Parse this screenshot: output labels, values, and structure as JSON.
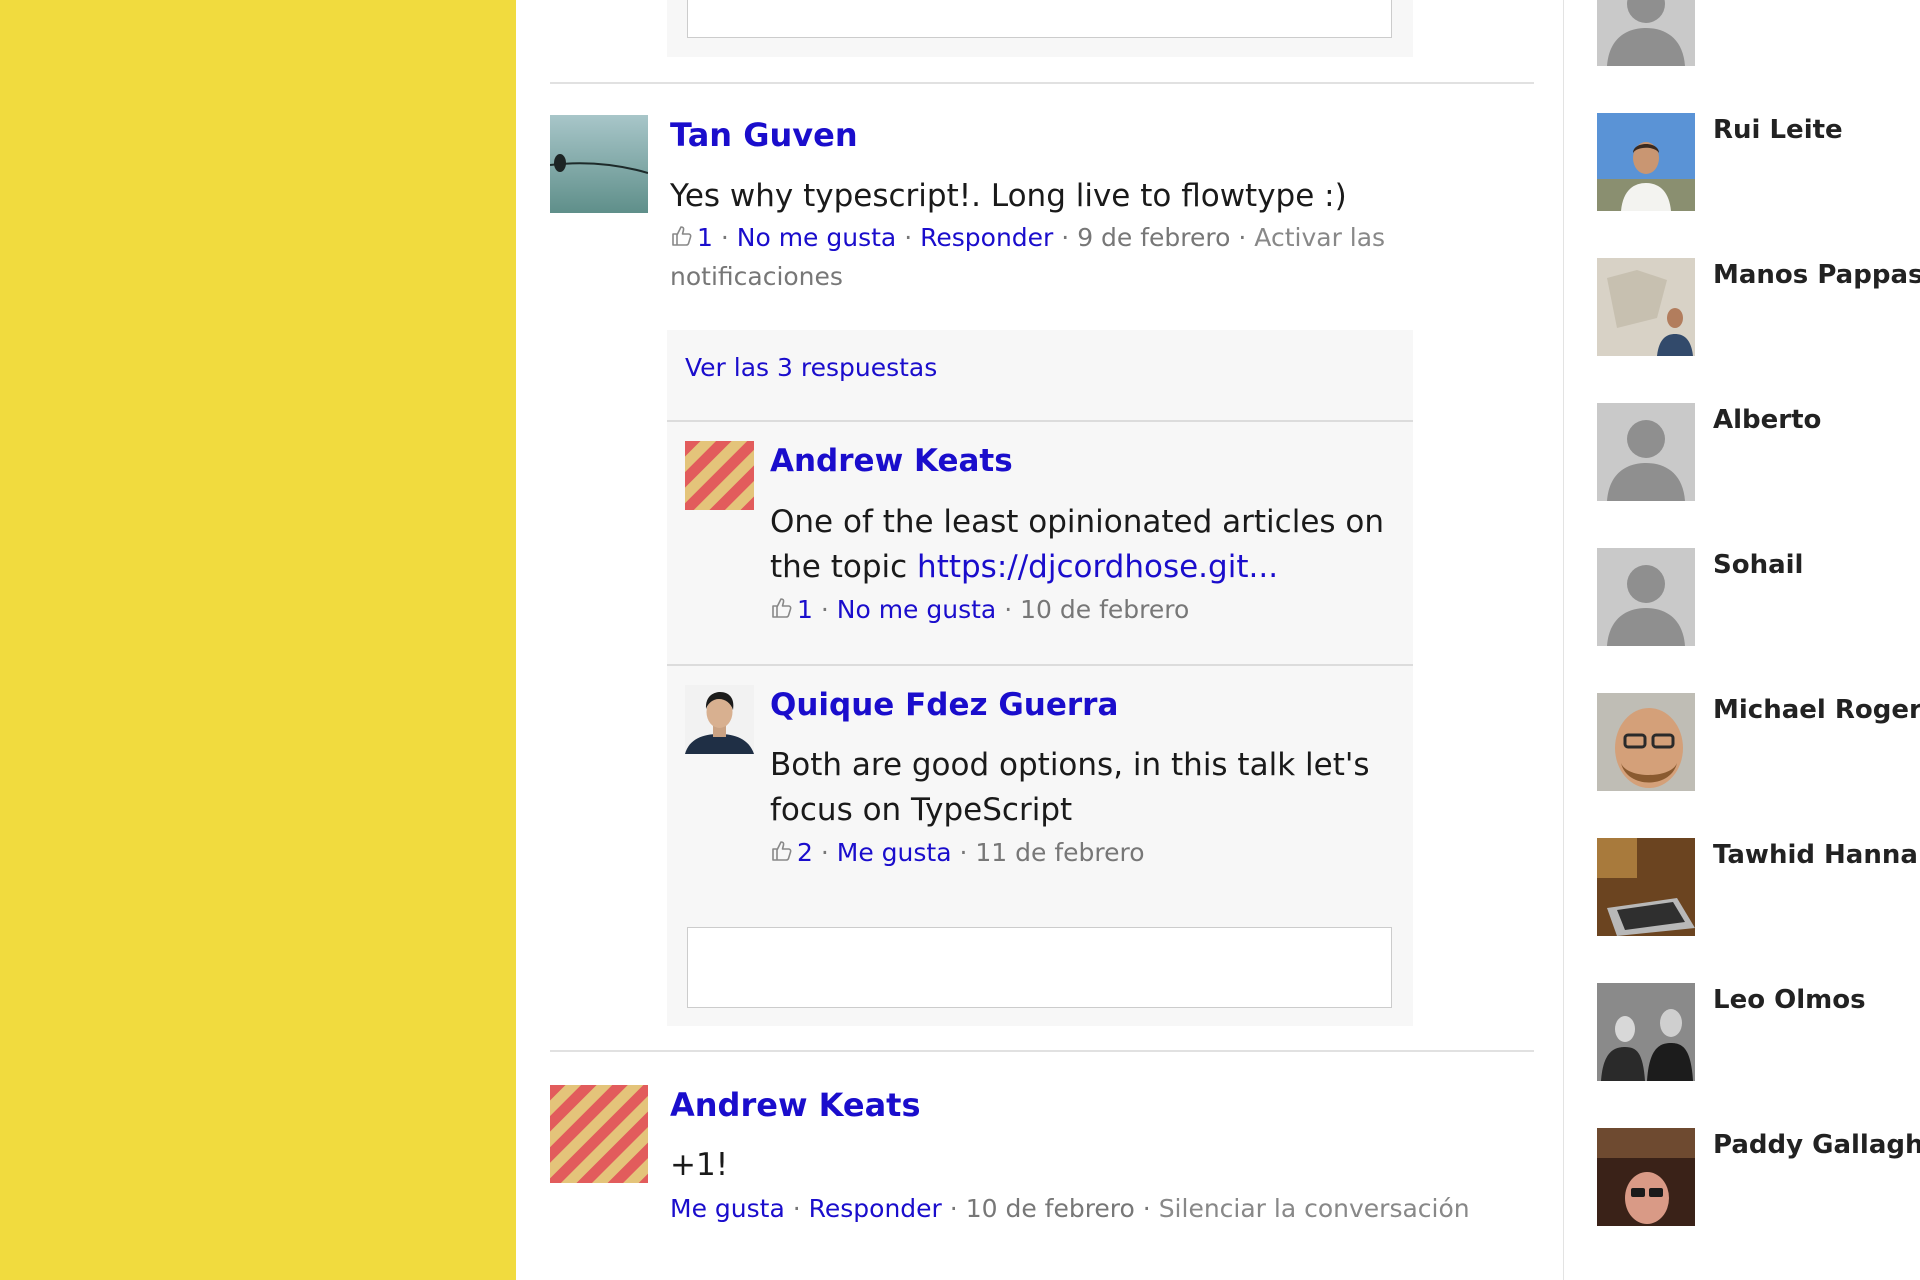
{
  "comments": [
    {
      "author": "Tan Guven",
      "text": "Yes why typescript!. Long live to flowtype :)",
      "likes": "1",
      "like_action": "No me gusta",
      "reply_action": "Responder",
      "date": "9 de febrero",
      "notify_line1": "Activar las",
      "notify_line2": "notificaciones",
      "show_replies": "Ver las 3 respuestas",
      "replies": [
        {
          "author": "Andrew Keats",
          "text_line1": "One of the least opinionated articles on",
          "text_line2_prefix": "the topic ",
          "link": "https://djcordhose.git...",
          "likes": "1",
          "like_action": "No me gusta",
          "date": "10 de febrero"
        },
        {
          "author": "Quique Fdez Guerra",
          "text_line1": "Both are good options, in this talk let's",
          "text_line2": "focus on TypeScript",
          "likes": "2",
          "like_action": "Me gusta",
          "date": "11 de febrero"
        }
      ]
    },
    {
      "author": "Andrew Keats",
      "text": "+1!",
      "like_action": "Me gusta",
      "reply_action": "Responder",
      "date": "10 de febrero",
      "mute_action": "Silenciar la conversación"
    }
  ],
  "separator_dot": "·",
  "people": [
    {
      "name": "",
      "avatar": "default-avatar"
    },
    {
      "name": "Rui Leite",
      "avatar": "photo"
    },
    {
      "name": "Manos Pappas",
      "avatar": "photo"
    },
    {
      "name": "Alberto",
      "avatar": "default-avatar"
    },
    {
      "name": "Sohail",
      "avatar": "default-avatar"
    },
    {
      "name": "Michael Roger",
      "avatar": "photo"
    },
    {
      "name": "Tawhid Hannan",
      "avatar": "photo"
    },
    {
      "name": "Leo Olmos",
      "avatar": "photo"
    },
    {
      "name": "Paddy Gallagher",
      "avatar": "photo"
    }
  ],
  "colors": {
    "side_panel": "#f1db3e",
    "link": "#1a0dcc",
    "reply_background": "#f7f7f7"
  }
}
